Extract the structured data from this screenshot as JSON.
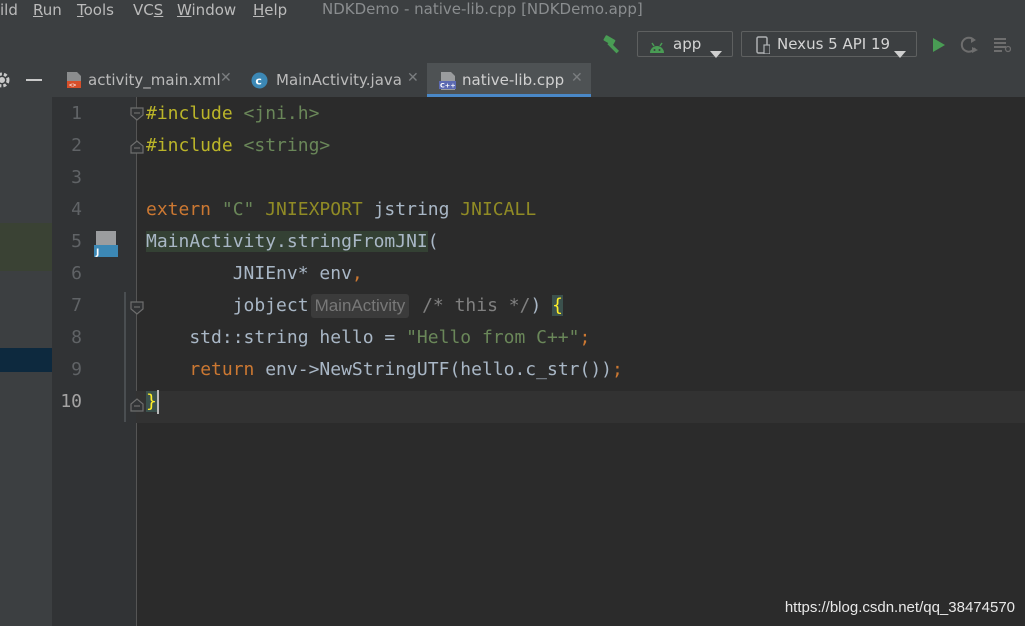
{
  "window_title": "NDKDemo - native-lib.cpp [NDKDemo.app]",
  "menu": [
    {
      "label": "ild",
      "underline": ""
    },
    {
      "label": "Run",
      "underline": "R"
    },
    {
      "label": "Tools",
      "underline": "T"
    },
    {
      "label": "VCS",
      "underline": "S"
    },
    {
      "label": "Window",
      "underline": "W"
    },
    {
      "label": "Help",
      "underline": "H"
    }
  ],
  "toolbar": {
    "run_config": "app",
    "device": "Nexus 5 API 19"
  },
  "tabs": [
    {
      "label": "activity_main.xml",
      "icon": "xml-file-icon",
      "active": false
    },
    {
      "label": "MainActivity.java",
      "icon": "java-class-icon",
      "active": false
    },
    {
      "label": "native-lib.cpp",
      "icon": "cpp-file-icon",
      "active": true
    }
  ],
  "editor": {
    "current_line": 10,
    "lines": [
      {
        "n": "1",
        "tokens": [
          {
            "t": "#include ",
            "c": "pp"
          },
          {
            "t": "<jni.h>",
            "c": "str"
          }
        ]
      },
      {
        "n": "2",
        "tokens": [
          {
            "t": "#include ",
            "c": "pp"
          },
          {
            "t": "<string>",
            "c": "str"
          }
        ]
      },
      {
        "n": "3",
        "tokens": []
      },
      {
        "n": "4",
        "tokens": [
          {
            "t": "extern ",
            "c": "kw"
          },
          {
            "t": "\"C\" ",
            "c": "str"
          },
          {
            "t": "JNIEXPORT ",
            "c": "macro"
          },
          {
            "t": "jstring ",
            "c": ""
          },
          {
            "t": "JNICALL",
            "c": "macro"
          }
        ]
      },
      {
        "n": "5",
        "tokens": [
          {
            "t": "MainActivity.stringFromJNI",
            "c": "fnhl"
          },
          {
            "t": "(",
            "c": ""
          }
        ]
      },
      {
        "n": "6",
        "tokens": [
          {
            "t": "        JNIEnv* env",
            "c": ""
          },
          {
            "t": ",",
            "c": "kw"
          }
        ]
      },
      {
        "n": "7",
        "tokens": [
          {
            "t": "        jobject",
            "c": ""
          },
          {
            "t": "MainActivity",
            "c": "hint"
          },
          {
            "t": " /* this */",
            "c": "cm"
          },
          {
            "t": ") ",
            "c": ""
          },
          {
            "t": "{",
            "c": "bracematch"
          }
        ]
      },
      {
        "n": "8",
        "tokens": [
          {
            "t": "    std::string hello = ",
            "c": ""
          },
          {
            "t": "\"Hello from C++\"",
            "c": "str"
          },
          {
            "t": ";",
            "c": "kw"
          }
        ]
      },
      {
        "n": "9",
        "tokens": [
          {
            "t": "    ",
            "c": ""
          },
          {
            "t": "return ",
            "c": "kw"
          },
          {
            "t": "env->NewStringUTF(hello.c_str())",
            "c": ""
          },
          {
            "t": ";",
            "c": "kw"
          }
        ]
      },
      {
        "n": "10",
        "tokens": [
          {
            "t": "}",
            "c": "bracematch"
          },
          {
            "t": "",
            "c": "caret"
          }
        ]
      }
    ]
  },
  "watermark": "https://blog.csdn.net/qq_38474570",
  "colors": {
    "keyword": "#cc7832",
    "string": "#6a8759",
    "preprocessor": "#bbb529",
    "macro": "#908b25",
    "run_green": "#499c54",
    "tab_underline": "#4a88c7"
  }
}
